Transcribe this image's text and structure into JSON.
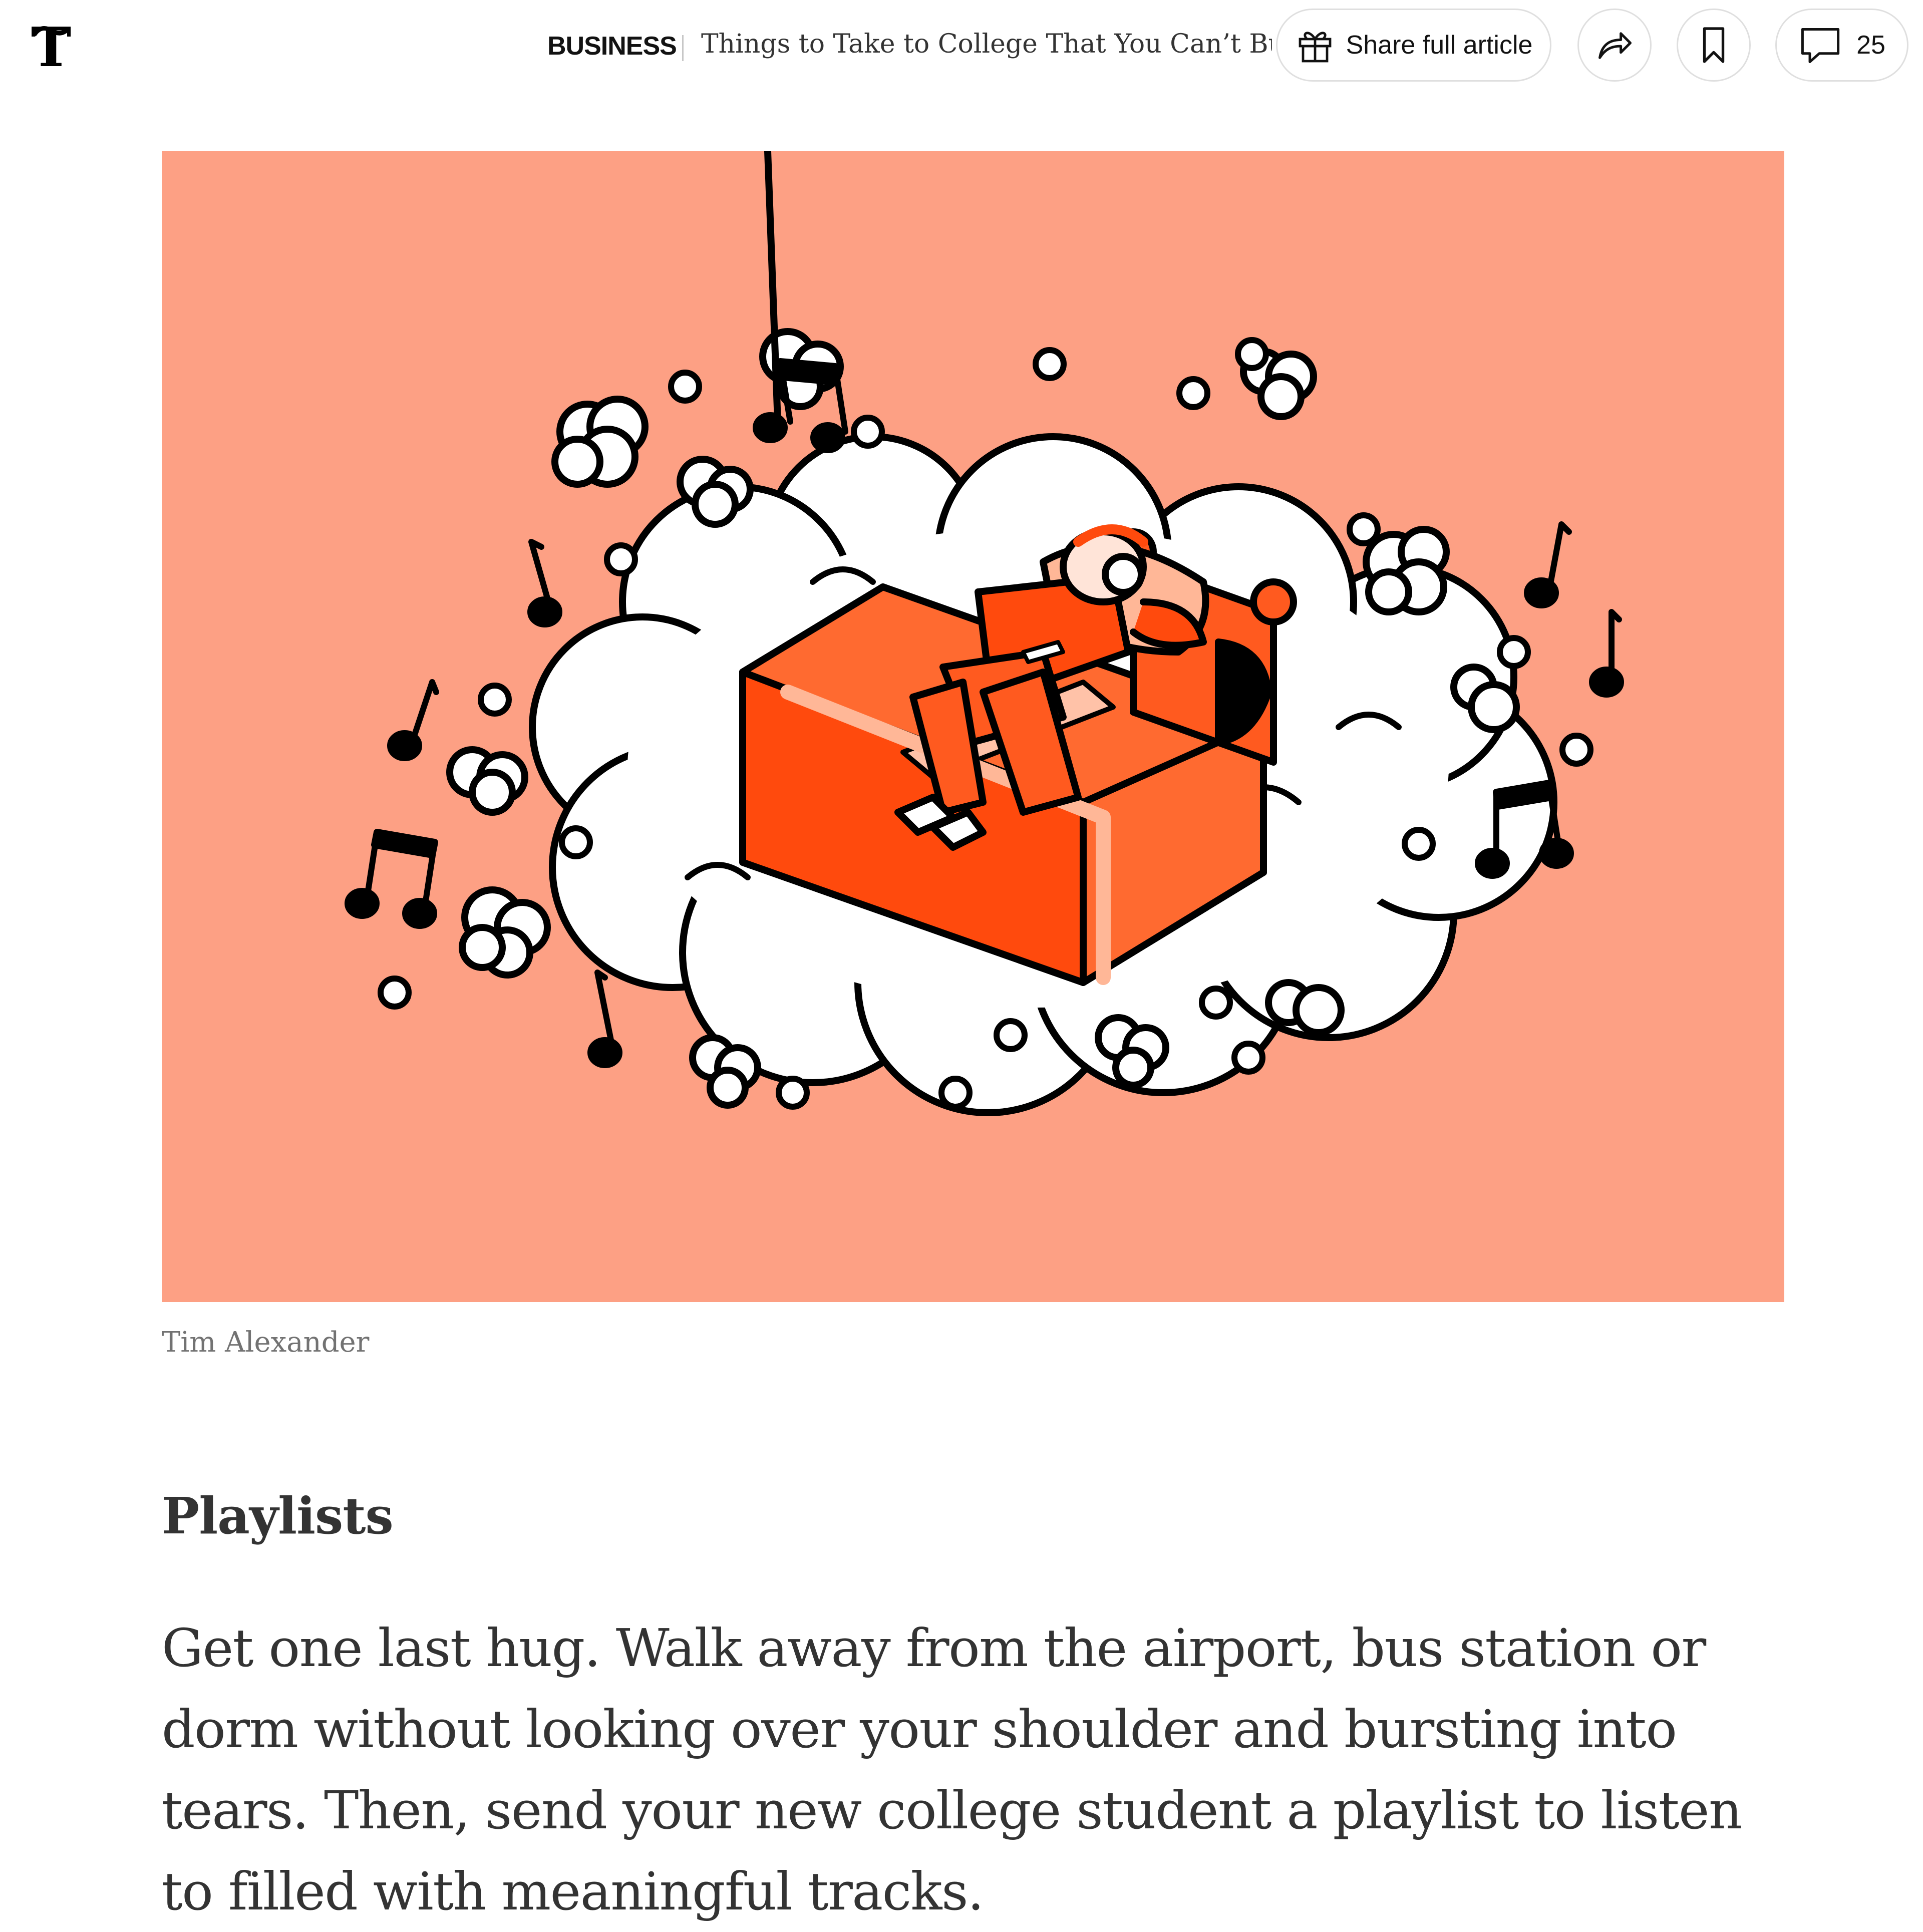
{
  "header": {
    "logo_icon": "nyt-t-logo-icon",
    "section": "BUSINESS",
    "headline": "Things to Take to College That You Can’t Buy",
    "share_full_label": "Share full article",
    "share_full_icon": "gift-icon",
    "share_icon": "share-arrow-icon",
    "save_icon": "bookmark-icon",
    "comments_icon": "comment-bubble-icon",
    "comments_count": "25"
  },
  "figure": {
    "description_icon": "illustration-person-in-bed-on-cloud-with-music-notes",
    "background_color": "#fda084",
    "accent_color": "#ff4a0d",
    "credit": "Tim Alexander"
  },
  "article": {
    "subhead": "Playlists",
    "paragraph": "Get one last hug. Walk away from the airport, bus station or dorm without looking over your shoulder and bursting into tears. Then, send your new college student a playlist to listen to filled with meaningful tracks."
  }
}
